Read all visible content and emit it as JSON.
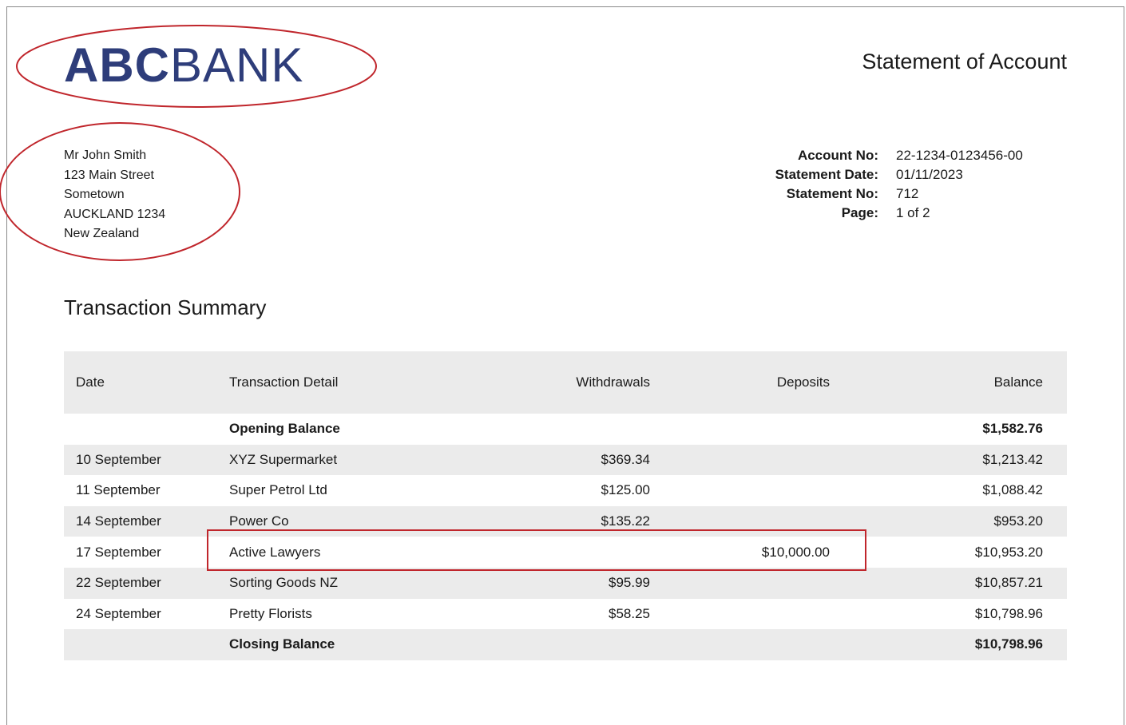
{
  "logo": {
    "bold": "ABC",
    "thin": "BANK"
  },
  "title": "Statement of Account",
  "address": [
    "Mr John Smith",
    "123 Main Street",
    "Sometown",
    "AUCKLAND 1234",
    "New Zealand"
  ],
  "account": {
    "account_no_label": "Account No:",
    "account_no": "22-1234-0123456-00",
    "statement_date_label": "Statement Date:",
    "statement_date": "01/11/2023",
    "statement_no_label": "Statement No:",
    "statement_no": "712",
    "page_label": "Page:",
    "page": "1 of 2"
  },
  "section_title": "Transaction Summary",
  "table": {
    "headers": {
      "date": "Date",
      "detail": "Transaction Detail",
      "withdrawals": "Withdrawals",
      "deposits": "Deposits",
      "balance": "Balance"
    },
    "rows": [
      {
        "date": "",
        "detail": "Opening Balance",
        "withdrawals": "",
        "deposits": "",
        "balance": "$1,582.76"
      },
      {
        "date": "10 September",
        "detail": "XYZ Supermarket",
        "withdrawals": "$369.34",
        "deposits": "",
        "balance": "$1,213.42"
      },
      {
        "date": "11 September",
        "detail": "Super Petrol Ltd",
        "withdrawals": "$125.00",
        "deposits": "",
        "balance": "$1,088.42"
      },
      {
        "date": "14 September",
        "detail": "Power Co",
        "withdrawals": "$135.22",
        "deposits": "",
        "balance": "$953.20"
      },
      {
        "date": "17 September",
        "detail": "Active Lawyers",
        "withdrawals": "",
        "deposits": "$10,000.00",
        "balance": "$10,953.20"
      },
      {
        "date": "22 September",
        "detail": "Sorting Goods NZ",
        "withdrawals": "$95.99",
        "deposits": "",
        "balance": "$10,857.21"
      },
      {
        "date": "24 September",
        "detail": "Pretty Florists",
        "withdrawals": "$58.25",
        "deposits": "",
        "balance": "$10,798.96"
      },
      {
        "date": "",
        "detail": "Closing Balance",
        "withdrawals": "",
        "deposits": "",
        "balance": "$10,798.96"
      }
    ]
  },
  "colors": {
    "brand": "#2e3d7a",
    "annotation": "#c0262c",
    "row_shade": "#ebebeb"
  }
}
